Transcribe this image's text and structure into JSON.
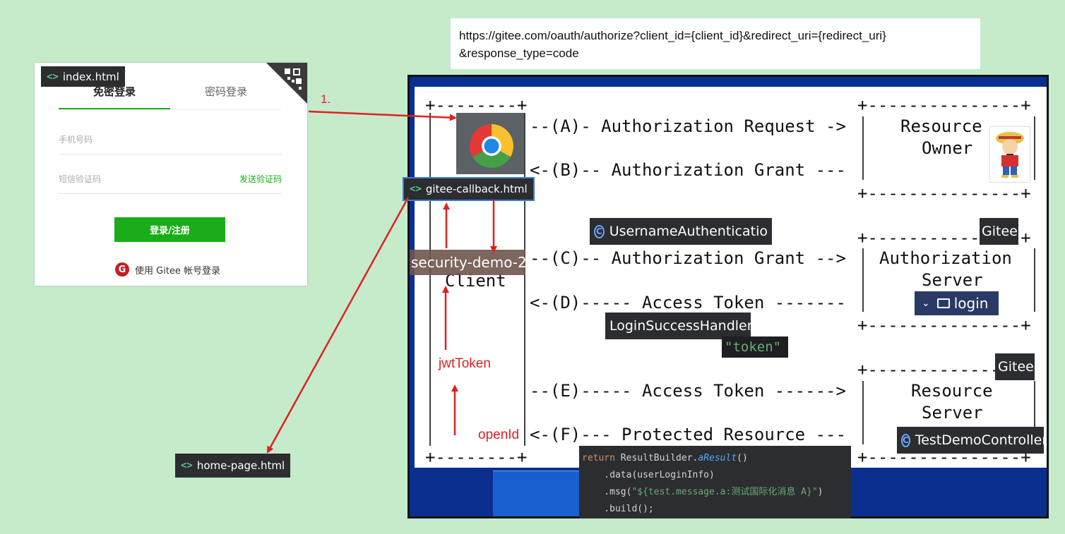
{
  "login": {
    "tab_quick": "免密登录",
    "tab_password": "密码登录",
    "phone_placeholder": "手机号码",
    "code_placeholder": "短信验证码",
    "send_code": "发送验证码",
    "login_button": "登录/注册",
    "gitee_login": "使用 Gitee 帐号登录",
    "gitee_logo_letter": "G"
  },
  "tags": {
    "index": "index.html",
    "callback": "gitee-callback.html",
    "home": "home-page.html",
    "code_icon": "<>"
  },
  "url": {
    "line1": "https://gitee.com/oauth/authorize?client_id={client_id}&redirect_uri={redirect_uri}",
    "line2": "&response_type=code"
  },
  "diagram": {
    "row_a": "--(A)- Authorization Request ->",
    "row_b": "<-(B)-- Authorization Grant ---",
    "row_c": "--(C)-- Authorization Grant -->",
    "row_d": "<-(D)----- Access Token -------",
    "row_e": "--(E)----- Access Token ------>",
    "row_f": "<-(F)--- Protected Resource ---",
    "resource_owner_1": "Resource",
    "resource_owner_2": "Owner",
    "auth_server_1": "Authorization",
    "auth_server_2": "Server",
    "resource_server_1": "Resource",
    "resource_server_2": "Server",
    "client": "Client"
  },
  "ide": {
    "username_auth": "UsernameAuthenticatio",
    "gitee_1": "Gitee",
    "gitee_2": "Gitee",
    "login_folder": "login",
    "login_success": "LoginSuccessHandler",
    "token": "\"token\"",
    "test_controller": "TestDemoController",
    "security_demo": "security-demo-2"
  },
  "code": {
    "line1_kw": "return",
    "line1_rest": " ResultBuilder.",
    "line1_fn": "aResult",
    "line1_end": "()",
    "line2": "    .data(userLoginInfo)",
    "line3_start": "    .msg(",
    "line3_str": "\"${test.message.a:测试国际化消息 A}\"",
    "line3_end": ")",
    "line4": "    .build();"
  },
  "labels": {
    "step": "1.",
    "jwt": "jwtToken",
    "openid": "openId"
  },
  "colors": {
    "background": "#c6ebcb",
    "arrow": "#e02020",
    "accent_green": "#1aad19",
    "gitee_red": "#c71d23"
  }
}
